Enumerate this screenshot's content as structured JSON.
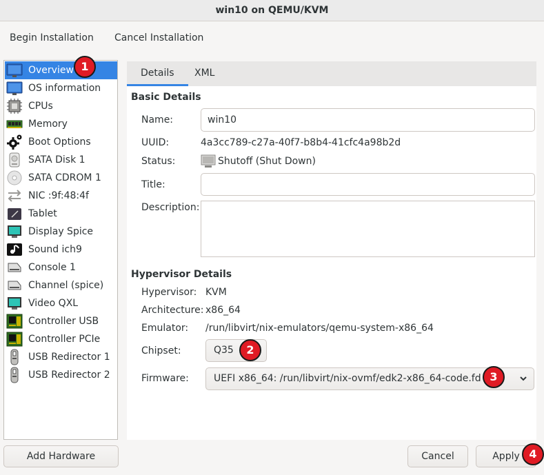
{
  "window": {
    "title": "win10 on QEMU/KVM"
  },
  "menubar": {
    "begin_label": "Begin Installation",
    "cancel_label": "Cancel Installation"
  },
  "hardware": {
    "items": [
      {
        "label": "Overview",
        "icon": "monitor-icon"
      },
      {
        "label": "OS information",
        "icon": "monitor-icon"
      },
      {
        "label": "CPUs",
        "icon": "cpu-icon"
      },
      {
        "label": "Memory",
        "icon": "memory-icon"
      },
      {
        "label": "Boot Options",
        "icon": "gear-icon"
      },
      {
        "label": "SATA Disk 1",
        "icon": "disk-icon"
      },
      {
        "label": "SATA CDROM 1",
        "icon": "cdrom-icon"
      },
      {
        "label": "NIC :9f:48:4f",
        "icon": "network-arrows-icon"
      },
      {
        "label": "Tablet",
        "icon": "tablet-icon"
      },
      {
        "label": "Display Spice",
        "icon": "display-icon"
      },
      {
        "label": "Sound ich9",
        "icon": "sound-icon"
      },
      {
        "label": "Console 1",
        "icon": "serial-icon"
      },
      {
        "label": "Channel (spice)",
        "icon": "serial-icon"
      },
      {
        "label": "Video QXL",
        "icon": "display-icon"
      },
      {
        "label": "Controller USB",
        "icon": "controller-icon"
      },
      {
        "label": "Controller PCIe",
        "icon": "controller-icon"
      },
      {
        "label": "USB Redirector 1",
        "icon": "usb-icon"
      },
      {
        "label": "USB Redirector 2",
        "icon": "usb-icon"
      }
    ],
    "add_label": "Add Hardware"
  },
  "tabs": [
    {
      "label": "Details"
    },
    {
      "label": "XML"
    }
  ],
  "basic": {
    "heading": "Basic Details",
    "name_label": "Name:",
    "name_value": "win10",
    "uuid_label": "UUID:",
    "uuid_value": "4a3cc789-c27a-40f7-b8b4-41cfc4a98b2d",
    "status_label": "Status:",
    "status_value": "Shutoff (Shut Down)",
    "title_label": "Title:",
    "title_value": "",
    "description_label": "Description:"
  },
  "hypervisor": {
    "heading": "Hypervisor Details",
    "hypervisor_label": "Hypervisor:",
    "hypervisor_value": "KVM",
    "arch_label": "Architecture:",
    "arch_value": "x86_64",
    "emulator_label": "Emulator:",
    "emulator_value": "/run/libvirt/nix-emulators/qemu-system-x86_64",
    "chipset_label": "Chipset:",
    "chipset_value": "Q35",
    "firmware_label": "Firmware:",
    "firmware_value": "UEFI x86_64: /run/libvirt/nix-ovmf/edk2-x86_64-code.fd"
  },
  "footer": {
    "cancel_label": "Cancel",
    "apply_label": "Apply"
  },
  "annotations": [
    "1",
    "2",
    "3",
    "4"
  ],
  "colors": {
    "accent": "#3584e4",
    "badge": "#e01b24"
  }
}
